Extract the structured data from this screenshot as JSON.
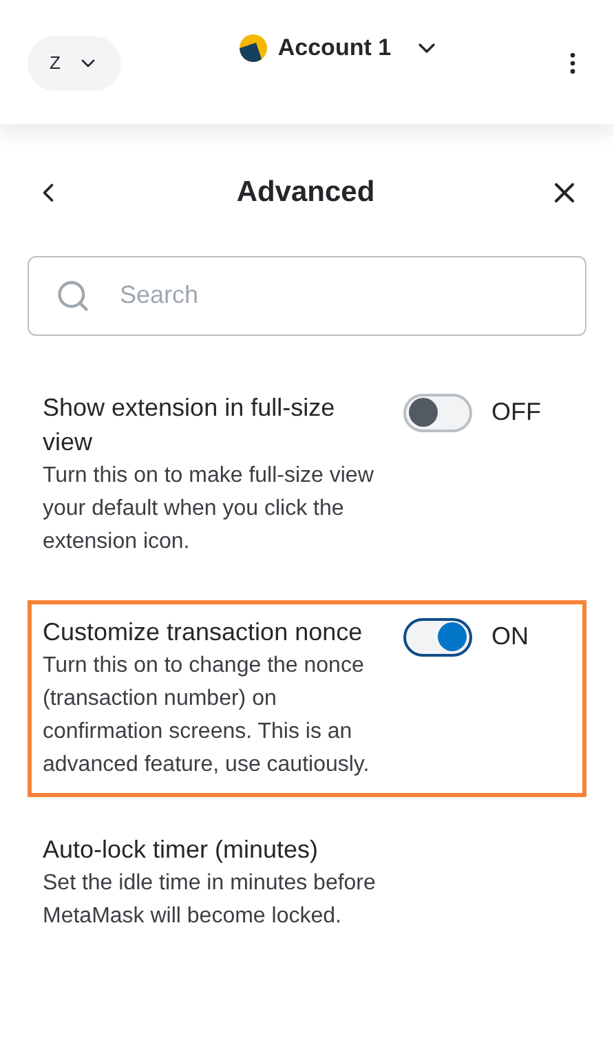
{
  "header": {
    "network": "Z",
    "account": "Account 1"
  },
  "page": {
    "title": "Advanced"
  },
  "search": {
    "placeholder": "Search"
  },
  "settings": [
    {
      "kind": "toggle",
      "title": "Show extension in full-size view",
      "description": "Turn this on to make full-size view your default when you click the extension icon.",
      "on": false,
      "state_label": "OFF",
      "highlighted": false
    },
    {
      "kind": "toggle",
      "title": "Customize transaction nonce",
      "description": "Turn this on to change the nonce (transaction number) on confirmation screens. This is an advanced feature, use cautiously.",
      "on": true,
      "state_label": "ON",
      "highlighted": true
    },
    {
      "kind": "plain",
      "title": "Auto-lock timer (minutes)",
      "description": "Set the idle time in minutes before MetaMask will become locked.",
      "highlighted": false
    }
  ]
}
